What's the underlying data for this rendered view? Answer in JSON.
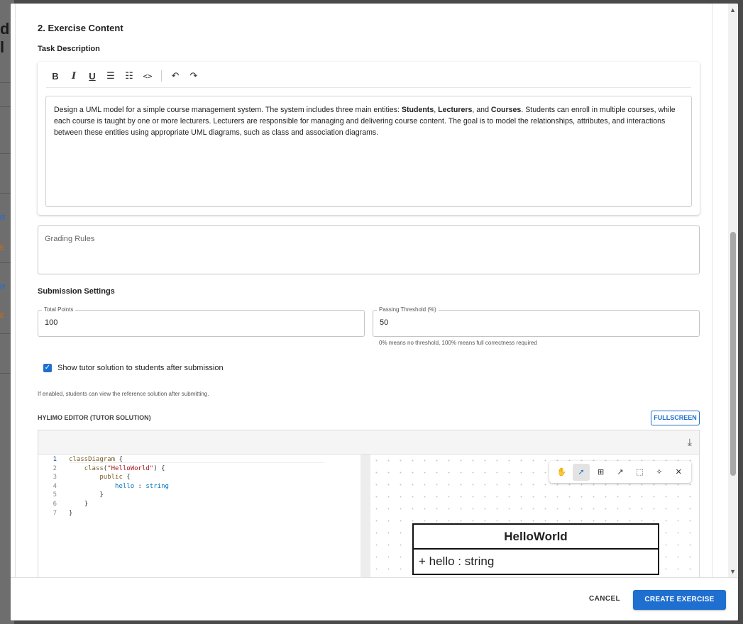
{
  "background": {
    "heading_fragment": "d l",
    "side_fragments": [
      {
        "text": "IT",
        "color": "#1f6fd0"
      },
      {
        "text": "E",
        "color": "#c26b1d"
      },
      {
        "text": "IT",
        "color": "#1f6fd0"
      },
      {
        "text": "E",
        "color": "#c26b1d"
      }
    ]
  },
  "section": {
    "title": "2. Exercise Content",
    "task_description_label": "Task Description"
  },
  "rich_editor": {
    "toolbar": [
      {
        "name": "bold",
        "glyph": "B"
      },
      {
        "name": "italic",
        "glyph": "I"
      },
      {
        "name": "underline",
        "glyph": "U"
      },
      {
        "name": "bullet-list",
        "glyph": "☰"
      },
      {
        "name": "ordered-list",
        "glyph": "☷"
      },
      {
        "name": "code",
        "glyph": "<>"
      },
      {
        "name": "undo",
        "glyph": "↶"
      },
      {
        "name": "redo",
        "glyph": "↷"
      }
    ],
    "content": {
      "p1": "Design a UML model for a simple course management system. The system includes three main entities: ",
      "b1": "Students",
      "p2": ", ",
      "b2": "Lecturers",
      "p3": ", and ",
      "b3": "Courses",
      "p4": ". Students can enroll in multiple courses, while each course is taught by one or more lecturers. Lecturers are responsible for managing and delivering course content. The goal is to model the relationships, attributes, and interactions between these entities using appropriate UML diagrams, such as class and association diagrams."
    }
  },
  "grading": {
    "placeholder": "Grading Rules"
  },
  "submission": {
    "title": "Submission Settings",
    "total_points_label": "Total Points",
    "total_points_value": "100",
    "threshold_label": "Passing Threshold (%)",
    "threshold_value": "50",
    "threshold_helper": "0% means no threshold, 100% means full correctness required",
    "show_solution_label": "Show tutor solution to students after submission",
    "show_solution_checked": true,
    "show_solution_helper": "If enabled, students can view the reference solution after submitting."
  },
  "hylimo": {
    "title": "HYLIMO EDITOR (TUTOR SOLUTION)",
    "fullscreen_label": "FULLSCREEN",
    "code_lines": [
      {
        "num": "1",
        "indent": "",
        "parts": [
          {
            "t": "classDiagram",
            "c": "kw"
          },
          {
            "t": " {",
            "c": ""
          }
        ]
      },
      {
        "num": "2",
        "indent": "    ",
        "parts": [
          {
            "t": "class",
            "c": "kw"
          },
          {
            "t": "(",
            "c": ""
          },
          {
            "t": "\"HelloWorld\"",
            "c": "str"
          },
          {
            "t": ") {",
            "c": ""
          }
        ]
      },
      {
        "num": "3",
        "indent": "        ",
        "parts": [
          {
            "t": "public",
            "c": "kw"
          },
          {
            "t": " {",
            "c": ""
          }
        ]
      },
      {
        "num": "4",
        "indent": "            ",
        "parts": [
          {
            "t": "hello",
            "c": "ident"
          },
          {
            "t": " : ",
            "c": ""
          },
          {
            "t": "string",
            "c": "ident"
          }
        ]
      },
      {
        "num": "5",
        "indent": "        ",
        "parts": [
          {
            "t": "}",
            "c": ""
          }
        ]
      },
      {
        "num": "6",
        "indent": "    ",
        "parts": [
          {
            "t": "}",
            "c": ""
          }
        ]
      },
      {
        "num": "7",
        "indent": "",
        "parts": [
          {
            "t": "}",
            "c": ""
          }
        ]
      }
    ],
    "canvas_tools": [
      {
        "name": "hand-icon",
        "glyph": "✋",
        "active": false
      },
      {
        "name": "pointer-icon",
        "glyph": "➚",
        "active": true
      },
      {
        "name": "add-element-icon",
        "glyph": "⊞",
        "active": false
      },
      {
        "name": "connect-arrow-icon",
        "glyph": "↗",
        "active": false
      },
      {
        "name": "select-box-icon",
        "glyph": "⬚",
        "active": false
      },
      {
        "name": "magic-wand-icon",
        "glyph": "✧",
        "active": false
      },
      {
        "name": "close-icon",
        "glyph": "✕",
        "active": false
      }
    ],
    "uml_class": {
      "name": "HelloWorld",
      "attribute": "+ hello : string"
    }
  },
  "footer": {
    "cancel_label": "CANCEL",
    "create_label": "CREATE EXERCISE"
  },
  "colors": {
    "primary": "#1f6fd0",
    "overlay": "#4a4a4a"
  }
}
